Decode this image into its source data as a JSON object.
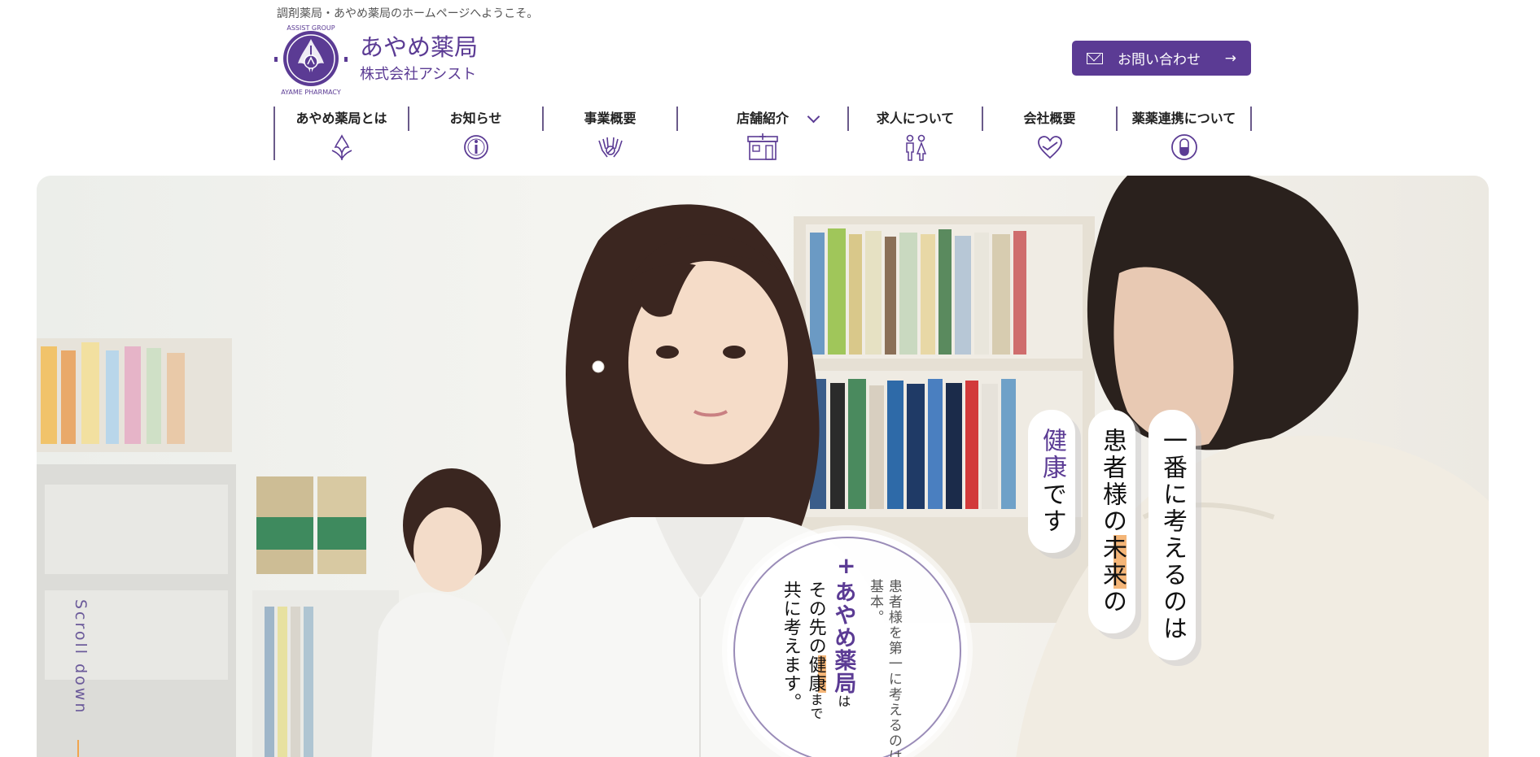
{
  "header": {
    "tagline": "調剤薬局・あやめ薬局のホームページへようこそ。",
    "logo_title": "あやめ薬局",
    "logo_subtitle": "株式会社アシスト",
    "logo_ring_top": "ASSIST GROUP",
    "logo_ring_bottom": "AYAME PHARMACY",
    "contact_label": "お問い合わせ",
    "contact_icon": "mail-icon",
    "contact_arrow": "→"
  },
  "nav": {
    "items": [
      {
        "label": "あやめ薬局とは",
        "icon": "iris-flower-icon"
      },
      {
        "label": "お知らせ",
        "icon": "info-icon"
      },
      {
        "label": "事業概要",
        "icon": "hands-care-icon"
      },
      {
        "label": "店舗紹介",
        "icon": "store-icon",
        "has_dropdown": true
      },
      {
        "label": "求人について",
        "icon": "people-icon"
      },
      {
        "label": "会社概要",
        "icon": "heart-hand-icon"
      },
      {
        "label": "薬薬連携について",
        "icon": "capsule-icon"
      }
    ]
  },
  "hero": {
    "pill_1": "一番に考えるのは",
    "pill_2_a": "患者様の",
    "pill_2_b": "未来",
    "pill_2_c": "の",
    "pill_3_a": "健康",
    "pill_3_b": "です",
    "circle_plus": "+",
    "circle_sub": "患者様を第一に考えるのは基本。",
    "circle_brand": "あやめ薬局",
    "circle_wa": "は",
    "circle_line2_a": "その先の",
    "circle_line2_b": "健康",
    "circle_line2_c": "まで",
    "circle_line3": "共に考えます。",
    "scroll_label": "Scroll down"
  },
  "colors": {
    "brand_purple": "#5b3b94",
    "accent_orange": "#f4b577",
    "scroll_line": "#f1a54d"
  }
}
